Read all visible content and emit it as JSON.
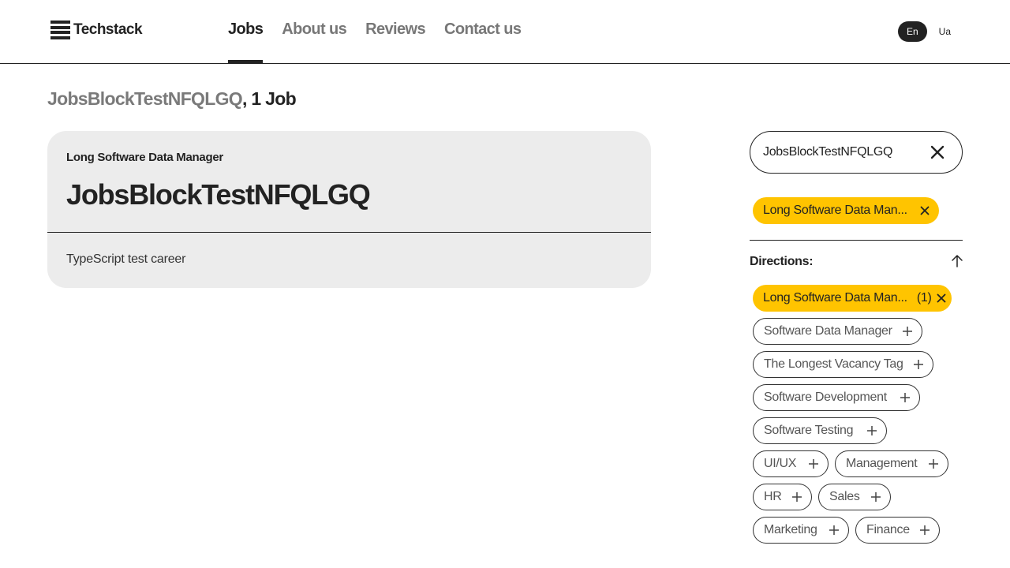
{
  "header": {
    "logo_text": "Techstack",
    "nav": [
      {
        "label": "Jobs",
        "active": true
      },
      {
        "label": "About us",
        "active": false
      },
      {
        "label": "Reviews",
        "active": false
      },
      {
        "label": "Contact us",
        "active": false
      }
    ],
    "languages": [
      {
        "label": "En",
        "active": true
      },
      {
        "label": "Ua",
        "active": false
      }
    ]
  },
  "results": {
    "query": "JobsBlockTestNFQLGQ",
    "count_text": ", 1 Job"
  },
  "job_card": {
    "tag": "Long Software Data Manager",
    "title": "JobsBlockTestNFQLGQ",
    "description": "TypeScript test career"
  },
  "search": {
    "value": "JobsBlockTestNFQLGQ",
    "clear_icon": "close-icon"
  },
  "active_filters": [
    {
      "label": "Long Software Data Man..."
    }
  ],
  "directions": {
    "label": "Directions:",
    "toggle_icon": "arrow-up-icon",
    "selected": [
      {
        "label": "Long Software Data Man...",
        "count": "(1)"
      }
    ],
    "options": [
      {
        "label": "Software Data Manager"
      },
      {
        "label": "The Longest Vacancy Tag"
      },
      {
        "label": "Software Development"
      },
      {
        "label": "Software Testing"
      },
      {
        "label": "UI/UX"
      },
      {
        "label": "Management"
      },
      {
        "label": "HR"
      },
      {
        "label": "Sales"
      },
      {
        "label": "Marketing"
      },
      {
        "label": "Finance"
      }
    ]
  },
  "colors": {
    "accent_yellow": "#ffc400",
    "card_bg": "#ececec",
    "text_dark": "#222222",
    "text_muted": "#777777"
  }
}
